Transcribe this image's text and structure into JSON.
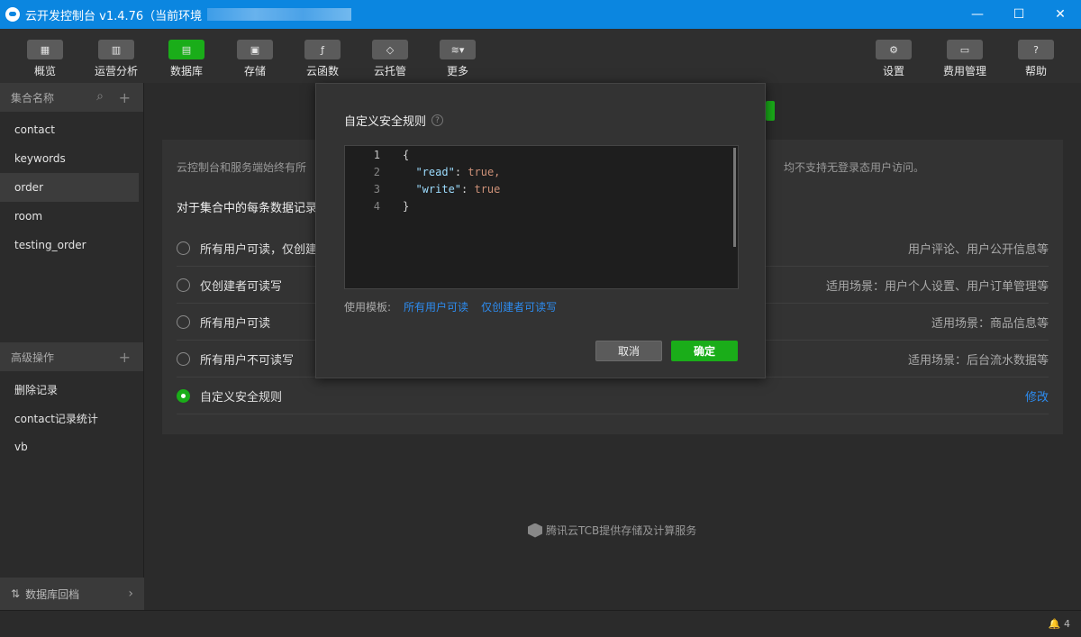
{
  "window": {
    "title": "云开发控制台 v1.4.76（当前环境",
    "controls": {
      "minimize": "—",
      "maximize": "☐",
      "close": "✕"
    }
  },
  "toolbar": {
    "left": [
      {
        "label": "概览",
        "icon": "grid-icon",
        "glyph": "▦",
        "active": false
      },
      {
        "label": "运营分析",
        "icon": "chart-icon",
        "glyph": "▥",
        "active": false
      },
      {
        "label": "数据库",
        "icon": "database-icon",
        "glyph": "▤",
        "active": true
      },
      {
        "label": "存储",
        "icon": "disk-icon",
        "glyph": "▣",
        "active": false
      },
      {
        "label": "云函数",
        "icon": "function-icon",
        "glyph": "ƒ",
        "active": false
      },
      {
        "label": "云托管",
        "icon": "cube-icon",
        "glyph": "◇",
        "active": false
      },
      {
        "label": "更多",
        "icon": "layers-icon",
        "glyph": "≋▾",
        "active": false
      }
    ],
    "right": [
      {
        "label": "设置",
        "icon": "gear-icon",
        "glyph": "⚙"
      },
      {
        "label": "费用管理",
        "icon": "billing-icon",
        "glyph": "▭"
      },
      {
        "label": "帮助",
        "icon": "help-icon",
        "glyph": "?"
      }
    ]
  },
  "sidebar": {
    "collections_header": "集合名称",
    "search_glyph": "⌕",
    "add_glyph": "+",
    "collections": [
      "contact",
      "keywords",
      "order",
      "room",
      "testing_order"
    ],
    "selected": "order",
    "advanced_header": "高级操作",
    "advanced_items": [
      "删除记录",
      "contact记录统计",
      "vb"
    ],
    "footer_label": "数据库回档",
    "footer_glyph": "⇅",
    "footer_chevron": "›"
  },
  "main": {
    "desc": "云控制台和服务端始终有所",
    "desc_right": "均不支持无登录态用户访问。",
    "heading": "对于集合中的每条数据记录",
    "options": [
      {
        "label": "所有用户可读，仅创建",
        "hint": "用户评论、用户公开信息等",
        "checked": false
      },
      {
        "label": "仅创建者可读写",
        "hint": "适用场景：用户个人设置、用户订单管理等",
        "checked": false
      },
      {
        "label": "所有用户可读",
        "hint": "适用场景：商品信息等",
        "checked": false
      },
      {
        "label": "所有用户不可读写",
        "hint": "适用场景：后台流水数据等",
        "checked": false
      },
      {
        "label": "自定义安全规则",
        "hint": "修改",
        "checked": true
      }
    ],
    "powered_by": "腾讯云TCB提供存储及计算服务"
  },
  "statusbar": {
    "notifications": "4",
    "bell_glyph": "🔔"
  },
  "dialog": {
    "title": "自定义安全规则",
    "help_glyph": "?",
    "code_lines": [
      {
        "num": "1",
        "text": "{"
      },
      {
        "num": "2",
        "key": "\"read\"",
        "val": "true,"
      },
      {
        "num": "3",
        "key": "\"write\"",
        "val": "true"
      },
      {
        "num": "4",
        "text": "}"
      }
    ],
    "template_label": "使用模板:",
    "templates": [
      "所有用户可读",
      "仅创建者可读写"
    ],
    "cancel_label": "取消",
    "ok_label": "确定"
  }
}
